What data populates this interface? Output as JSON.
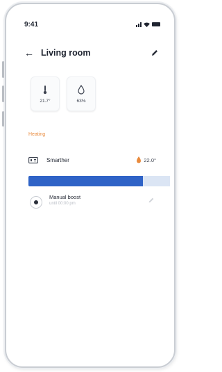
{
  "status_bar": {
    "time": "9:41"
  },
  "header": {
    "title": "Living room"
  },
  "sensors": [
    {
      "icon": "thermometer-icon",
      "value": "21.7°"
    },
    {
      "icon": "humidity-drop-icon",
      "value": "63%"
    }
  ],
  "section": {
    "label": "Heating"
  },
  "device": {
    "name": "Smarther",
    "setpoint": "22.0°"
  },
  "heating_bar": {
    "level": 0.75,
    "fill_color": "#2f63c7",
    "track_color": "#dbe5f4"
  },
  "boost": {
    "title": "Manual boost",
    "subtitle": "until 00:00 pm"
  },
  "colors": {
    "accent_orange": "#e98a3c",
    "text_dark": "#1f2430"
  }
}
